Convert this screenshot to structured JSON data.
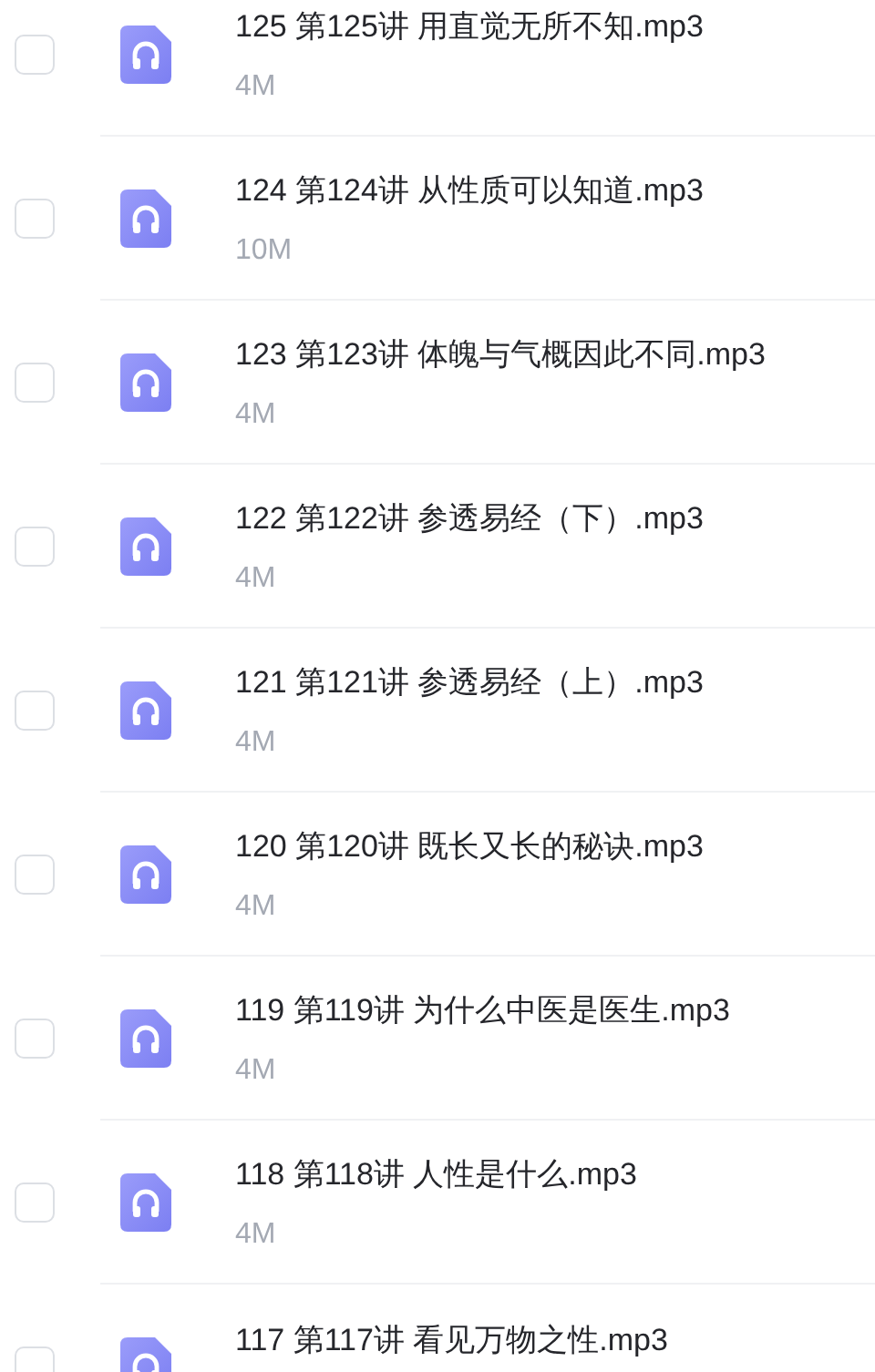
{
  "files": [
    {
      "name": "125 第125讲 用直觉无所不知.mp3",
      "size": "4M",
      "checked": false
    },
    {
      "name": "124 第124讲 从性质可以知道.mp3",
      "size": "10M",
      "checked": false
    },
    {
      "name": "123 第123讲 体魄与气概因此不同.mp3",
      "size": "4M",
      "checked": false
    },
    {
      "name": "122 第122讲 参透易经（下）.mp3",
      "size": "4M",
      "checked": false
    },
    {
      "name": "121 第121讲 参透易经（上）.mp3",
      "size": "4M",
      "checked": false
    },
    {
      "name": "120 第120讲 既长又长的秘诀.mp3",
      "size": "4M",
      "checked": false
    },
    {
      "name": "119 第119讲 为什么中医是医生.mp3",
      "size": "4M",
      "checked": false
    },
    {
      "name": "118 第118讲 人性是什么.mp3",
      "size": "4M",
      "checked": false
    },
    {
      "name": "117 第117讲 看见万物之性.mp3",
      "checked": false
    }
  ]
}
